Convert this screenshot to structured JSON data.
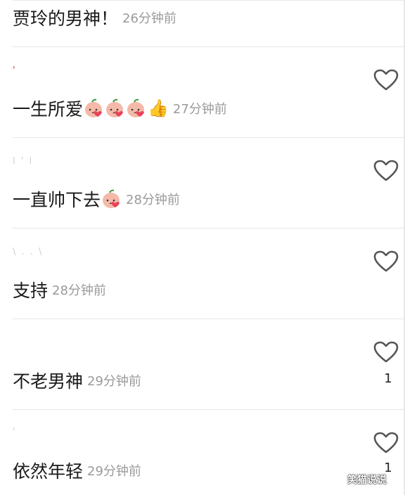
{
  "comments": [
    {
      "username": "",
      "text": "贾玲的男神！",
      "emojis": 0,
      "thumb": false,
      "time": "26分钟前",
      "likes": ""
    },
    {
      "username": "'",
      "text": "一生所爱",
      "emojis": 3,
      "thumb": true,
      "time": "27分钟前",
      "likes": ""
    },
    {
      "username": "l ' l ",
      "text": "一直帅下去",
      "emojis": 1,
      "thumb": false,
      "time": "28分钟前",
      "likes": ""
    },
    {
      "username": "\\ . . \\",
      "text": "支持",
      "emojis": 0,
      "thumb": false,
      "time": "28分钟前",
      "likes": ""
    },
    {
      "username": "",
      "text": "不老男神",
      "emojis": 0,
      "thumb": false,
      "time": "29分钟前",
      "likes": "1"
    },
    {
      "username": "'",
      "text": "依然年轻",
      "emojis": 0,
      "thumb": false,
      "time": "29分钟前",
      "likes": "1"
    }
  ],
  "watermark": "笑猫说说",
  "icons": {
    "like": "heart-outline-icon",
    "emoji": "peach-kiss-emoji-icon",
    "thumb": "thumbs-up-icon"
  },
  "colors": {
    "text": "#1a1a1a",
    "time": "#9a9a9a",
    "divider": "#e6e6e6",
    "heart_stroke": "#555555",
    "emoji_skin": "#f4b9a8",
    "emoji_blush": "#e8435a"
  }
}
